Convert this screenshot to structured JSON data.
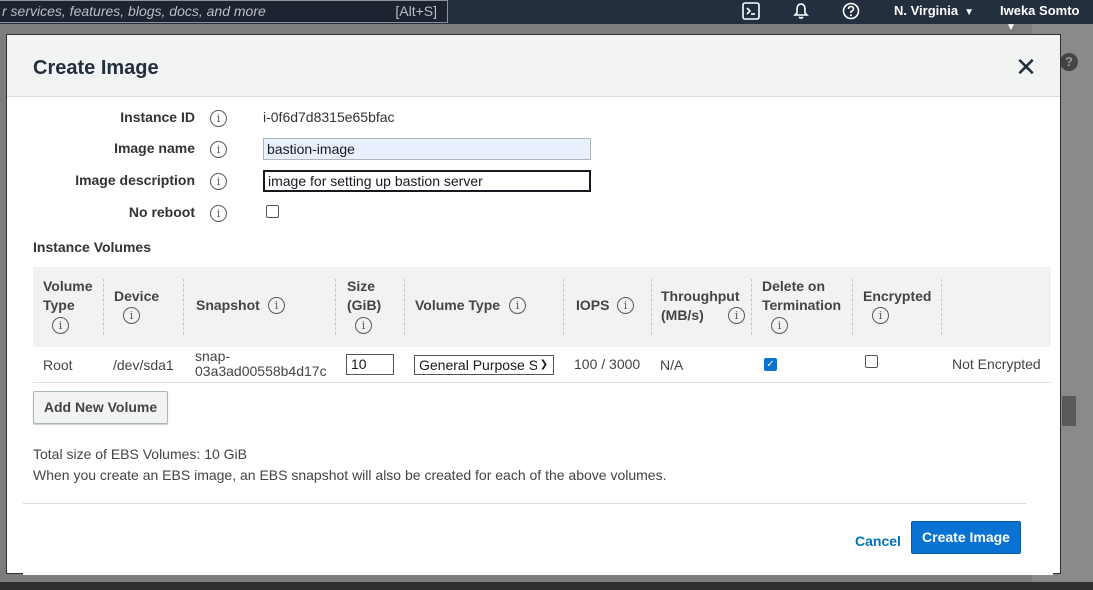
{
  "topnav": {
    "search_placeholder": "r services, features, blogs, docs, and more",
    "search_shortcut": "[Alt+S]",
    "region": "N. Virginia",
    "user": "Iweka Somto",
    "icons": [
      "cloudshell-icon",
      "bell-icon",
      "help-icon"
    ]
  },
  "modal": {
    "title": "Create Image",
    "close_glyph": "✕",
    "fields": {
      "instance_id_label": "Instance ID",
      "instance_id_value": "i-0f6d7d8315e65bfac",
      "image_name_label": "Image name",
      "image_name_value": "bastion-image",
      "image_description_label": "Image description",
      "image_description_value": "image for setting up bastion server",
      "no_reboot_label": "No reboot",
      "no_reboot_checked": false
    },
    "volumes_section_title": "Instance Volumes",
    "table": {
      "headers": {
        "volume_type_1": "Volume",
        "volume_type_2": "Type",
        "device": "Device",
        "snapshot": "Snapshot",
        "size_1": "Size",
        "size_2": "(GiB)",
        "volume_type": "Volume Type",
        "iops": "IOPS",
        "throughput_1": "Throughput",
        "throughput_2": "(MB/s)",
        "delete_1": "Delete on",
        "delete_2": "Termination",
        "encrypted": "Encrypted"
      },
      "rows": [
        {
          "volume_type": "Root",
          "device": "/dev/sda1",
          "snapshot_1": "snap-",
          "snapshot_2": "03a3ad00558b4d17c",
          "size": "10",
          "type_select": "General Purpose S",
          "iops": "100 / 3000",
          "throughput": "N/A",
          "delete_on_termination": true,
          "encrypted": false,
          "encrypted_status": "Not Encrypted"
        }
      ]
    },
    "add_volume_label": "Add New Volume",
    "total_size_text": "Total size of EBS Volumes: 10 GiB",
    "snapshot_note": "When you create an EBS image, an EBS snapshot will also be created for each of the above volumes.",
    "cancel_label": "Cancel",
    "create_label": "Create Image",
    "info_glyph": "i",
    "colors": {
      "primary": "#0972d3",
      "link": "#0073bb",
      "header_bg": "#f2f3f3",
      "nav_bg": "#232f3e"
    }
  }
}
